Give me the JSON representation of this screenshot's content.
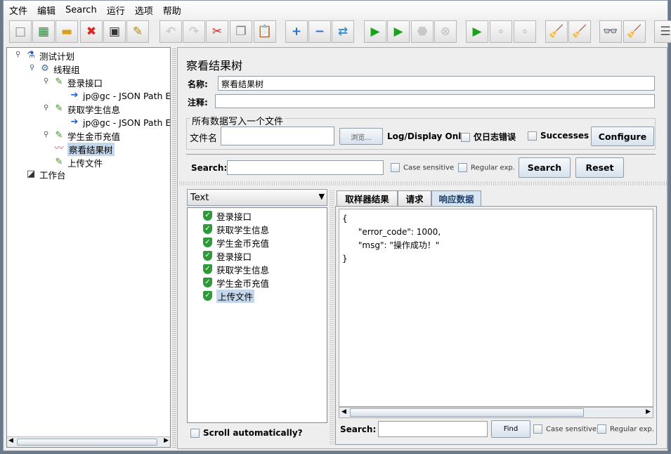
{
  "menu": [
    "文件",
    "编辑",
    "Search",
    "运行",
    "选项",
    "帮助"
  ],
  "toolbar": [
    {
      "icon": "new-icon",
      "glyph": "□",
      "color": "#888",
      "dis": false
    },
    {
      "icon": "templates-icon",
      "glyph": "▦",
      "color": "#2b8a3e",
      "dis": false
    },
    {
      "icon": "open-icon",
      "glyph": "▬",
      "color": "#d9a020",
      "dis": false
    },
    {
      "icon": "close-icon",
      "glyph": "✖",
      "color": "#d22",
      "dis": false
    },
    {
      "icon": "save-icon",
      "glyph": "▣",
      "color": "#333",
      "dis": false
    },
    {
      "icon": "save-as-icon",
      "glyph": "✎",
      "color": "#b8860b",
      "dis": false
    },
    {
      "icon": "undo-icon",
      "glyph": "↶",
      "color": "#ccc",
      "dis": true
    },
    {
      "icon": "redo-icon",
      "glyph": "↷",
      "color": "#ccc",
      "dis": true
    },
    {
      "icon": "cut-icon",
      "glyph": "✂",
      "color": "#d22",
      "dis": false
    },
    {
      "icon": "copy-icon",
      "glyph": "❐",
      "color": "#777",
      "dis": false
    },
    {
      "icon": "paste-icon",
      "glyph": "📋",
      "color": "#a67c2e",
      "dis": false
    },
    {
      "icon": "expand-icon",
      "glyph": "+",
      "color": "#2a6fc9",
      "dis": false
    },
    {
      "icon": "collapse-icon",
      "glyph": "−",
      "color": "#2a6fc9",
      "dis": false
    },
    {
      "icon": "toggle-icon",
      "glyph": "⇄",
      "color": "#3a8fc9",
      "dis": false
    },
    {
      "icon": "start-icon",
      "glyph": "▶",
      "color": "#1aa31a",
      "dis": false
    },
    {
      "icon": "start-no-pauses-icon",
      "glyph": "▶",
      "color": "#1aa31a",
      "dis": false
    },
    {
      "icon": "stop-icon",
      "glyph": "⬣",
      "color": "#c8c8c8",
      "dis": true
    },
    {
      "icon": "shutdown-icon",
      "glyph": "⊗",
      "color": "#c8c8c8",
      "dis": true
    },
    {
      "icon": "remote-start-icon",
      "glyph": "▶",
      "color": "#1aa31a",
      "dis": false
    },
    {
      "icon": "remote-stop-icon",
      "glyph": "∘",
      "color": "#c8c8c8",
      "dis": true
    },
    {
      "icon": "remote-shutdown-icon",
      "glyph": "∘",
      "color": "#c8c8c8",
      "dis": true
    },
    {
      "icon": "clear-icon",
      "glyph": "🧹",
      "color": "#a67c2e",
      "dis": false
    },
    {
      "icon": "clear-all-icon",
      "glyph": "🧹",
      "color": "#a67c2e",
      "dis": false
    },
    {
      "icon": "search-icon",
      "glyph": "👓",
      "color": "#222",
      "dis": false
    },
    {
      "icon": "reset-search-icon",
      "glyph": "🧹",
      "color": "#e0b000",
      "dis": false
    },
    {
      "icon": "function-helper-icon",
      "glyph": "☰",
      "color": "#555",
      "dis": false
    }
  ],
  "tree": [
    {
      "label": "测试计划",
      "icon": "test-plan-icon",
      "glyph": "⚗",
      "color": "#2a5db0",
      "level": 0
    },
    {
      "label": "线程组",
      "icon": "thread-group-icon",
      "glyph": "⚙",
      "color": "#3a6ea5",
      "level": 1
    },
    {
      "label": "登录接口",
      "icon": "sampler-icon",
      "glyph": "✎",
      "color": "#3c8a2e",
      "level": 2
    },
    {
      "label": "jp@gc - JSON Path Extractor",
      "icon": "extractor-icon",
      "glyph": "➔",
      "color": "#1e5fd0",
      "level": 3
    },
    {
      "label": "获取学生信息",
      "icon": "sampler-icon",
      "glyph": "✎",
      "color": "#3c8a2e",
      "level": 2
    },
    {
      "label": "jp@gc - JSON Path Extractor",
      "icon": "extractor-icon",
      "glyph": "➔",
      "color": "#1e5fd0",
      "level": 3
    },
    {
      "label": "学生金币充值",
      "icon": "sampler-icon",
      "glyph": "✎",
      "color": "#3c8a2e",
      "level": 2
    },
    {
      "label": "察看结果树",
      "icon": "listener-icon",
      "glyph": "〰",
      "color": "#c05080",
      "level": 2,
      "selected": true
    },
    {
      "label": "上传文件",
      "icon": "sampler-icon",
      "glyph": "✎",
      "color": "#3c8a2e",
      "level": 2
    },
    {
      "label": "工作台",
      "icon": "workbench-icon",
      "glyph": "◪",
      "color": "#333",
      "level": 0
    }
  ],
  "main": {
    "title": "察看结果树",
    "name_label": "名称:",
    "name_value": "察看结果树",
    "comments_label": "注释:",
    "comments_value": "",
    "file_group": "所有数据写入一个文件",
    "filename_label": "文件名",
    "filename_value": "",
    "browse": "浏览...",
    "log_only": "Log/Display Only:",
    "errors": "仅日志错误",
    "successes": "Successes",
    "configure": "Configure",
    "search_label": "Search:",
    "search_value": "",
    "case_sensitive": "Case sensitive",
    "regex": "Regular exp.",
    "search_btn": "Search",
    "reset_btn": "Reset",
    "renderer": "Text",
    "results": [
      "登录接口",
      "获取学生信息",
      "学生金币充值",
      "登录接口",
      "获取学生信息",
      "学生金币充值",
      "上传文件"
    ],
    "scroll_auto": "Scroll automatically?",
    "tabs": [
      "取样器结果",
      "请求",
      "响应数据"
    ],
    "active_tab": "响应数据",
    "response_lines": [
      "{",
      "      \"error_code\": 1000,",
      "      \"msg\": \"操作成功！\"",
      "}"
    ],
    "find_label": "Search:",
    "find_value": "",
    "find_btn": "Find",
    "find_case": "Case sensitive",
    "find_regex": "Regular exp."
  }
}
